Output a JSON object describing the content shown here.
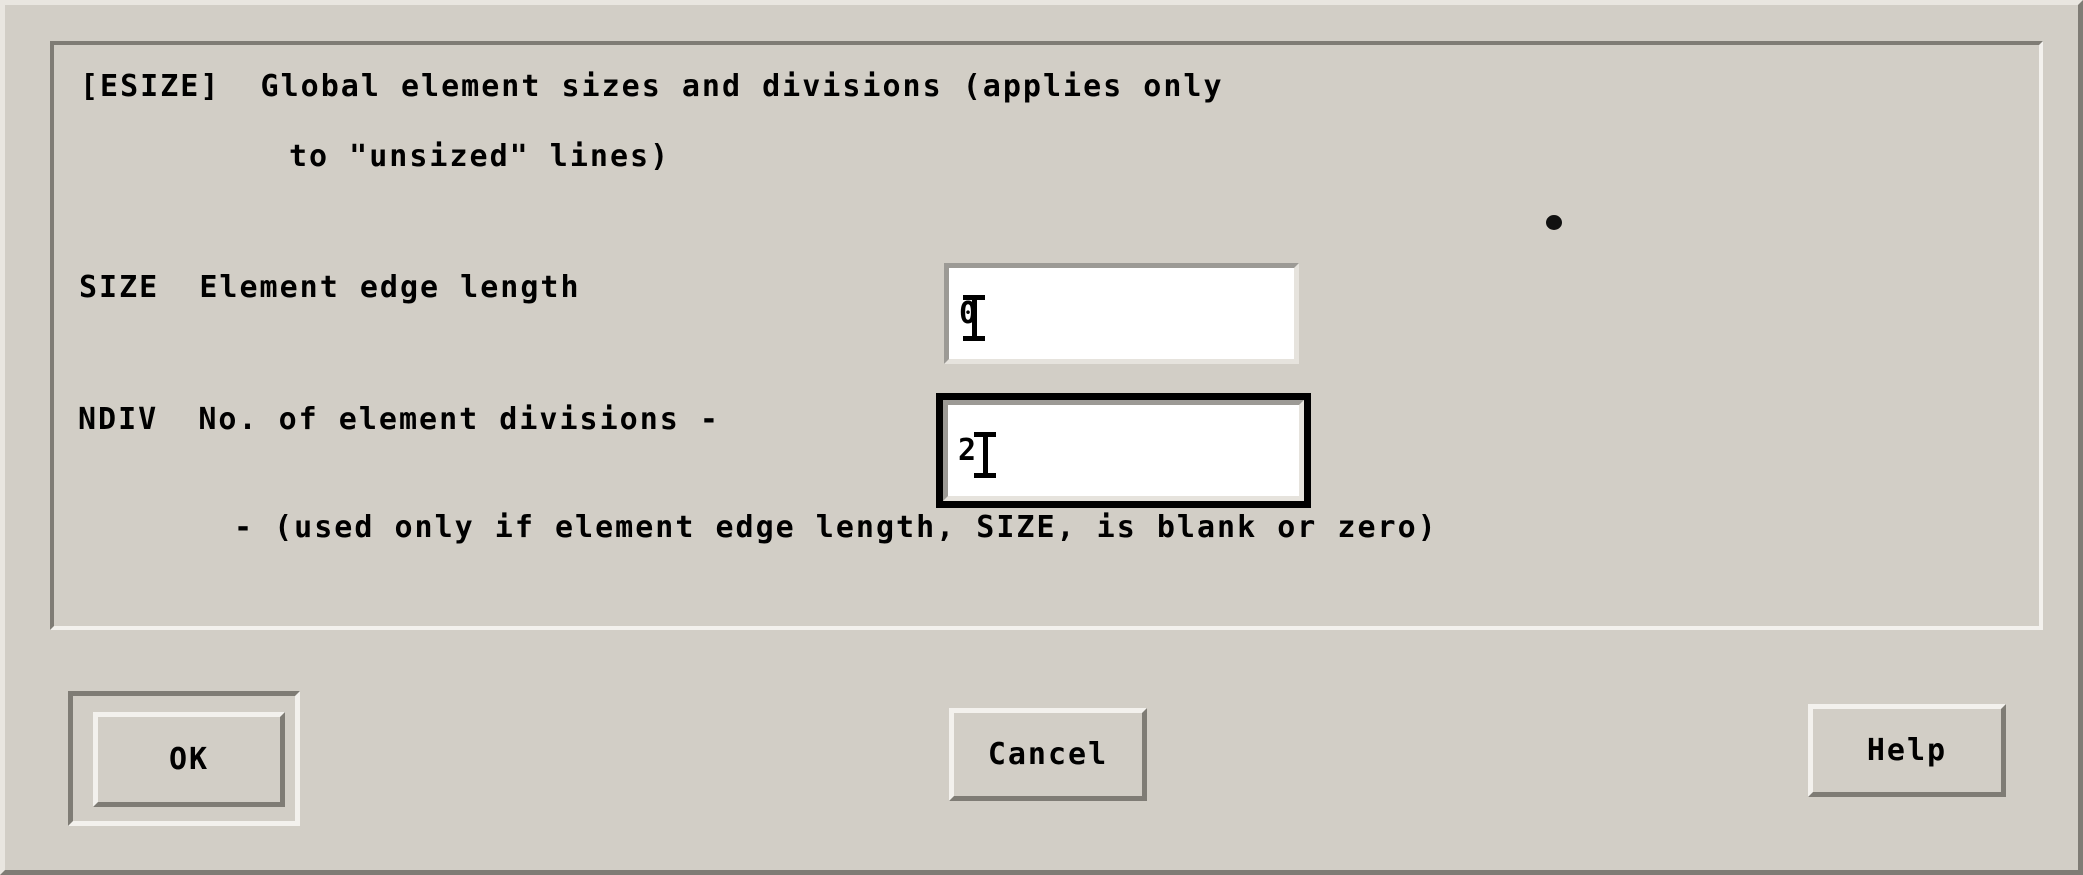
{
  "dialog": {
    "header_line1": "[ESIZE]  Global element sizes and divisions (applies only",
    "header_line2": "to \"unsized\" lines)",
    "note": "- (used only if element edge length, SIZE, is blank or zero)"
  },
  "fields": {
    "size": {
      "label": "SIZE  Element edge length",
      "value": "0",
      "focused": false
    },
    "ndiv": {
      "label": "NDIV  No. of element divisions -",
      "value": "2",
      "focused": true
    }
  },
  "buttons": {
    "ok": "OK",
    "cancel": "Cancel",
    "help": "Help"
  },
  "colors": {
    "background": "#d2cec6",
    "shadow": "#7f7c75",
    "highlight": "#f3f1ed",
    "field_background": "#ffffff",
    "focus_border": "#000000",
    "text": "#000000"
  }
}
